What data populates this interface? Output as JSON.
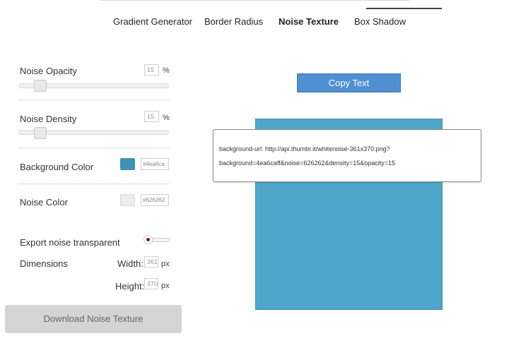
{
  "tabs": [
    {
      "label": "Gradient Generator",
      "active": false
    },
    {
      "label": "Border Radius",
      "active": false
    },
    {
      "label": "Noise Texture",
      "active": true
    },
    {
      "label": "Box Shadow",
      "active": false
    }
  ],
  "controls": {
    "noise_opacity": {
      "label": "Noise Opacity",
      "value": "15",
      "unit": "%"
    },
    "noise_density": {
      "label": "Noise Density",
      "value": "15",
      "unit": "%"
    },
    "background_color": {
      "label": "Background Color",
      "value": "#4ea6ca",
      "swatch": "#3e93b4"
    },
    "noise_color": {
      "label": "Noise Color",
      "value": "#626262",
      "swatch": "#ececec"
    },
    "export_transparent": {
      "label": "Export noise transparent",
      "enabled": false
    },
    "dimensions": {
      "label": "Dimensions",
      "width_label": "Width:",
      "width_value": "361",
      "height_label": "Height:",
      "height_value": "370",
      "unit": "px"
    }
  },
  "download_button": {
    "label": "Download Noise Texture"
  },
  "copy_button": {
    "label": "Copy Text"
  },
  "output": {
    "line1": "background-url: http://api.thumbr.it/whitenoise-361x370.png?",
    "line2": "background=4ea6caff&noise=626262&density=15&opacity=15"
  },
  "colors": {
    "accent": "#4f8fd2",
    "preview_bg": "#4ea6ca"
  }
}
